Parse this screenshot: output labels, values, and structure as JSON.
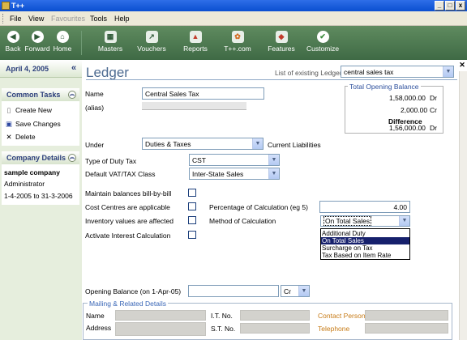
{
  "window": {
    "title": "T++",
    "minimize": "_",
    "maximize": "□",
    "close": "x"
  },
  "menu": [
    {
      "label": "File",
      "enabled": true
    },
    {
      "label": "View",
      "enabled": true
    },
    {
      "label": "Favourites",
      "enabled": false
    },
    {
      "label": "Tools",
      "enabled": true
    },
    {
      "label": "Help",
      "enabled": true
    }
  ],
  "toolbar": {
    "back": "Back",
    "forward": "Forward",
    "home": "Home",
    "masters": "Masters",
    "vouchers": "Vouchers",
    "reports": "Reports",
    "tpp": "T++.com",
    "features": "Features",
    "customize": "Customize"
  },
  "sidebar": {
    "date": "April 4, 2005",
    "collapse": "«",
    "common_tasks": {
      "title": "Common Tasks",
      "items": [
        {
          "label": "Create New",
          "icon": "new-doc-icon"
        },
        {
          "label": "Save Changes",
          "icon": "save-icon"
        },
        {
          "label": "Delete",
          "icon": "delete-icon"
        }
      ]
    },
    "company": {
      "title": "Company Details",
      "name": "sample company",
      "user": "Administrator",
      "period": "1-4-2005 to 31-3-2006"
    }
  },
  "ledger": {
    "title": "Ledger",
    "list_label": "List of existing Ledger",
    "list_value": "central sales tax",
    "name_label": "Name",
    "name_value": "Central Sales Tax",
    "alias_label": "(alias)",
    "under_label": "Under",
    "under_value": "Duties & Taxes",
    "under_group": "Current Liabilities",
    "duty_type_label": "Type of Duty Tax",
    "duty_type_value": "CST",
    "vat_class_label": "Default VAT/TAX Class",
    "vat_class_value": "Inter-State Sales",
    "maintain_bbb": "Maintain balances bill-by-bill",
    "cost_centres": "Cost Centres are applicable",
    "inventory": "Inventory values are affected",
    "interest": "Activate Interest Calculation",
    "pct_label": "Percentage of Calculation (eg 5)",
    "pct_value": "4.00",
    "method_label": "Method of Calculation",
    "method_value": "On Total Sales",
    "method_options": [
      "Additional Duty",
      "On Total Sales",
      "Surcharge on Tax",
      "Tax Based on Item Rate"
    ],
    "method_selected_index": 1,
    "opening_label": "Opening Balance  (on  1-Apr-05)",
    "opening_drcr": "Cr"
  },
  "total_opening": {
    "title": "Total Opening Balance",
    "dr_value": "1,58,000.00",
    "dr_label": "Dr",
    "cr_value": "2,000.00",
    "cr_label": "Cr",
    "diff_label": "Difference",
    "diff_value": "1,56,000.00",
    "diff_suffix": "Dr"
  },
  "mailing": {
    "title": "Mailing & Related Details",
    "name_label": "Name",
    "address_label": "Address",
    "it_label": "I.T. No.",
    "st_label": "S.T. No.",
    "contact_label": "Contact Person",
    "phone_label": "Telephone"
  },
  "colors": {
    "accent": "#4d6b91",
    "toolbar": "#4a7550",
    "sidebar": "#e6eedd",
    "selection": "#16206c",
    "orange_label": "#c77b17"
  }
}
